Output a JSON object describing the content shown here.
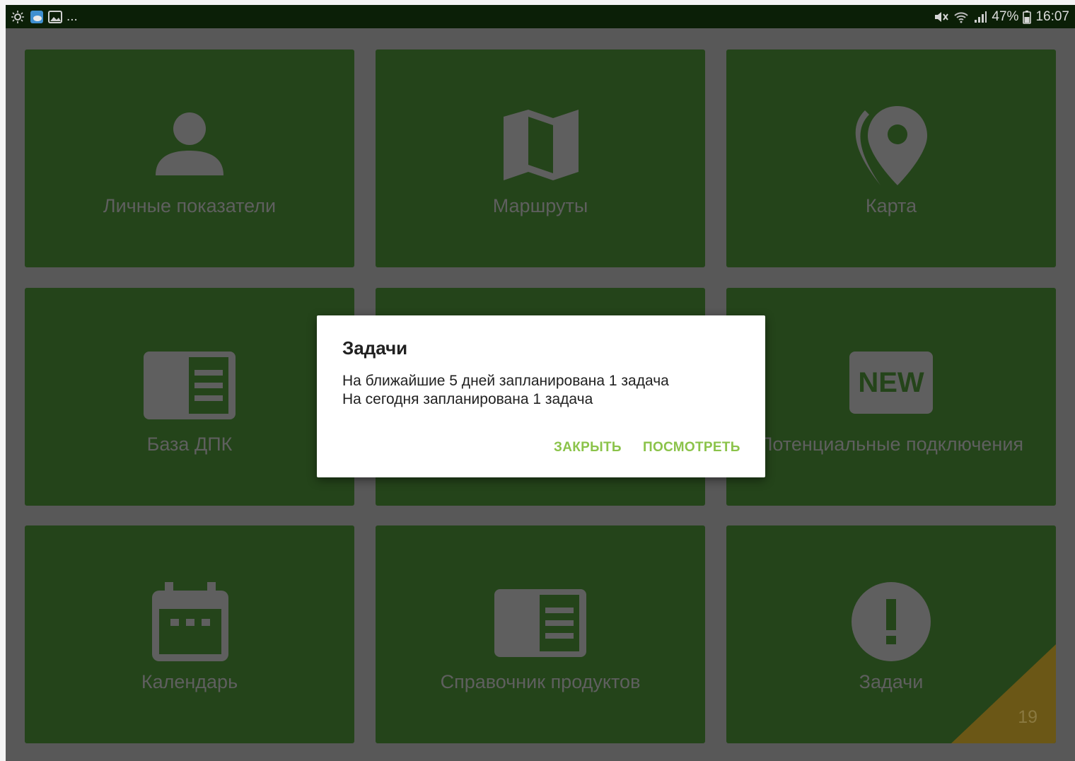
{
  "status_bar": {
    "notifications_more": "...",
    "battery": "47%",
    "time": "16:07"
  },
  "tiles": [
    {
      "label": "Личные показатели",
      "icon": "person-icon"
    },
    {
      "label": "Маршруты",
      "icon": "map-icon"
    },
    {
      "label": "Карта",
      "icon": "location-pin-icon"
    },
    {
      "label": "База ДПК",
      "icon": "catalog-icon"
    },
    {
      "label": "",
      "icon": ""
    },
    {
      "label": "Потенциальные подключения",
      "icon": "new-badge-icon",
      "icon_text": "NEW"
    },
    {
      "label": "Календарь",
      "icon": "calendar-icon"
    },
    {
      "label": "Справочник продуктов",
      "icon": "catalog-icon"
    },
    {
      "label": "Задачи",
      "icon": "alert-icon",
      "badge": "19"
    }
  ],
  "dialog": {
    "title": "Задачи",
    "line1": "На ближайшие 5 дней запланирована 1 задача",
    "line2": "На сегодня запланирована 1 задача",
    "close_label": "ЗАКРЫТЬ",
    "view_label": "ПОСМОТРЕТЬ"
  },
  "colors": {
    "tile_bg": "#24441a",
    "icon_gray": "#5f5f5f",
    "accent_green": "#8bc34a",
    "badge_orange": "#6b5716",
    "statusbar_bg": "#0b1f07"
  }
}
